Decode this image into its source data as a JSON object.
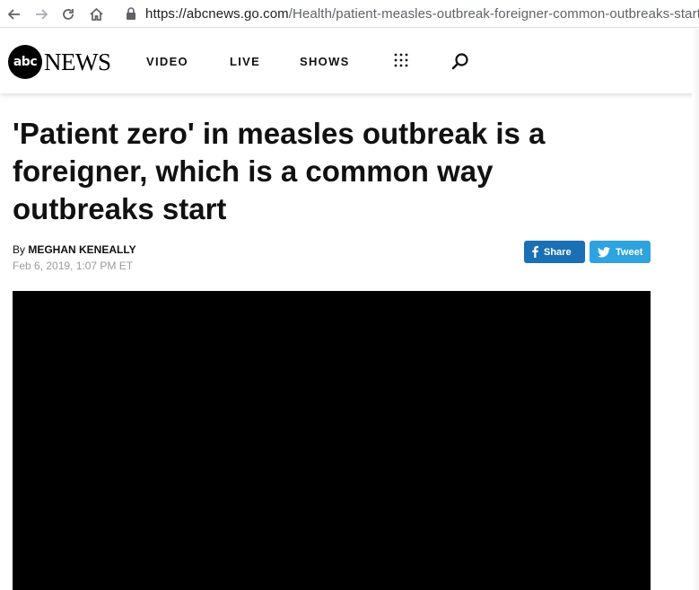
{
  "browser": {
    "url_host": "https://abcnews.go.com",
    "url_path": "/Health/patient-measles-outbreak-foreigner-common-outbreaks-start/"
  },
  "header": {
    "logo_abc": "abc",
    "logo_news": "NEWS",
    "nav": [
      "VIDEO",
      "LIVE",
      "SHOWS"
    ]
  },
  "article": {
    "headline": "'Patient zero' in measles outbreak is a foreigner, which is a common way outbreaks start",
    "byline_prefix": "By ",
    "author": "MEGHAN KENEALLY",
    "date": "Feb 6, 2019, 1:07 PM ET",
    "share_facebook": "Share",
    "share_twitter": "Tweet"
  },
  "colors": {
    "facebook": "#1b6fb5",
    "twitter": "#2ea3e0"
  }
}
